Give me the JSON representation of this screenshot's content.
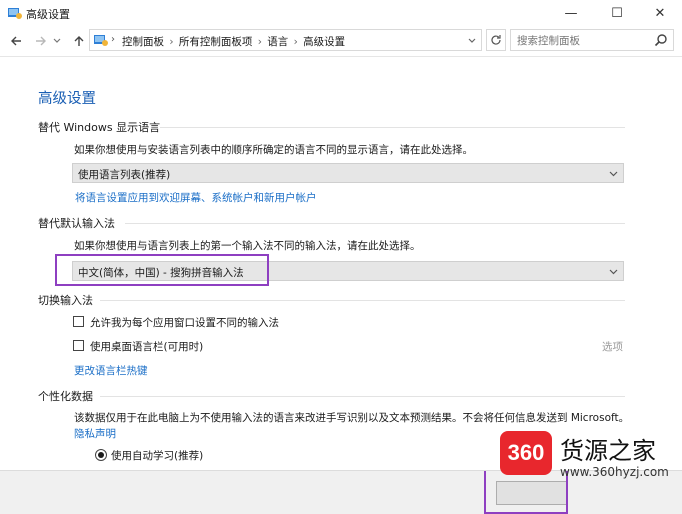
{
  "window": {
    "title": "高级设置",
    "minimize_glyph": "—",
    "maximize_glyph": "☐",
    "close_glyph": "✕"
  },
  "address": {
    "breadcrumbs": [
      "控制面板",
      "所有控制面板项",
      "语言",
      "高级设置"
    ],
    "separator": "›",
    "search_placeholder": "搜索控制面板"
  },
  "page": {
    "title": "高级设置",
    "display_language": {
      "heading": "替代 Windows 显示语言",
      "description": "如果你想使用与安装语言列表中的顺序所确定的语言不同的显示语言，请在此处选择。",
      "selected": "使用语言列表(推荐)",
      "apply_link": "将语言设置应用到欢迎屏幕、系统帐户和新用户帐户"
    },
    "default_input": {
      "heading": "替代默认输入法",
      "description": "如果你想使用与语言列表上的第一个输入法不同的输入法，请在此处选择。",
      "selected": "中文(简体，中国) - 搜狗拼音输入法"
    },
    "switch_input": {
      "heading": "切换输入法",
      "checkbox1": "允许我为每个应用窗口设置不同的输入法",
      "checkbox2": "使用桌面语言栏(可用时)",
      "options_link": "选项",
      "hotkeys_link": "更改语言栏热键"
    },
    "personalization": {
      "heading": "个性化数据",
      "description": "该数据仅用于在此电脑上为不使用输入法的语言来改进手写识别以及文本预测结果。不会将任何信息发送到 Microsoft。",
      "privacy_link": "隐私声明",
      "radio_label": "使用自动学习(推荐)"
    }
  },
  "watermark": {
    "badge": "360",
    "name": "货源之家",
    "url": "www.360hyzj.com"
  },
  "colors": {
    "accent_title": "#1a5fb4",
    "link": "#1a6ec7",
    "highlight": "#8e3fc1",
    "watermark_red": "#e8272d"
  }
}
